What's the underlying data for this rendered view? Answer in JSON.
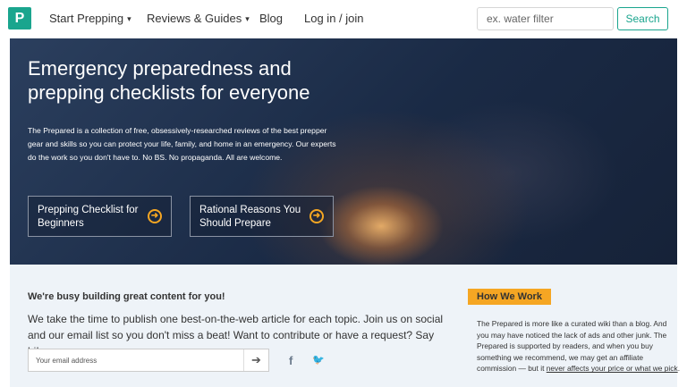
{
  "nav": {
    "logo_text": "P",
    "start_prepping": "Start Prepping",
    "reviews_guides": "Reviews & Guides",
    "blog": "Blog",
    "login": "Log in / join",
    "search_placeholder": "ex. water filter",
    "search_button": "Search",
    "caret": "▾"
  },
  "hero": {
    "title": "Emergency preparedness and prepping checklists for everyone",
    "description": "The Prepared is a collection of free, obsessively-researched reviews of the best prepper gear and skills so you can protect your life, family, and home in an emergency. Our experts do the work so you don't have to. No BS. No propaganda. All are welcome.",
    "cta1": "Prepping Checklist for Beginners",
    "cta2": "Rational Reasons You Should Prepare",
    "arrow_glyph": "➜"
  },
  "lower": {
    "busy_heading": "We're busy building great content for you!",
    "busy_text": "We take the time to publish one best-on-the-web article for each topic. Join us on social and our email list so you don't miss a beat! Want to contribute or have a request? Say hi!",
    "email_placeholder": "Your email address",
    "submit_glyph": "➔",
    "facebook_glyph": "f",
    "twitter_glyph": "🐦"
  },
  "how_we_work": {
    "badge": "How We Work",
    "text": "The Prepared is more like a curated wiki than a blog. And you may have noticed the lack of ads and other junk. The Prepared is supported by readers, and when you buy something we recommend, we may get an affiliate commission — but it ",
    "link": "never affects your price or what we pick",
    "tail": "."
  },
  "colors": {
    "brand": "#1aa58e",
    "accent": "#f5a623"
  }
}
